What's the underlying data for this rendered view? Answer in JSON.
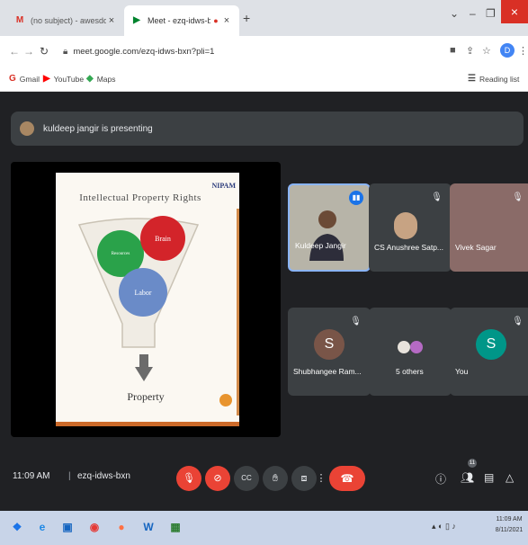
{
  "browser": {
    "tabs": [
      {
        "label": "(no subject) - awesddfsertanda"
      },
      {
        "label": "Meet - ezq-idws-bxn"
      }
    ],
    "url": "meet.google.com/ezq-idws-bxn?pli=1",
    "profile_initial": "D",
    "bookmarks": [
      "Gmail",
      "YouTube",
      "Maps"
    ],
    "reading_list": "Reading list"
  },
  "meet": {
    "presenting": "kuldeep jangir is presenting",
    "slide": {
      "title": "Intellectual Property Rights",
      "logo": "NIPAM",
      "circles": [
        "Resources",
        "Brain",
        "Labor"
      ],
      "bottom_label": "Property"
    },
    "tiles": [
      {
        "name": "Kuldeep Jangir"
      },
      {
        "name": "CS Anushree Satp..."
      },
      {
        "name": "Vivek Sagar"
      },
      {
        "name": "Shubhangee Ram...",
        "letter": "S"
      },
      {
        "name": "5 others"
      },
      {
        "name": "You",
        "letter": "S"
      }
    ],
    "time": "11:09 AM",
    "separator": "|",
    "meeting_code": "ezq-idws-bxn",
    "participants_badge": "11"
  },
  "taskbar": {
    "clock_time": "11:09 AM",
    "clock_date": "8/11/2021"
  },
  "icons": {
    "gmail": "gmail-icon",
    "meet": "meet-icon",
    "mic_off": "mic-off-icon",
    "camera_off": "camera-off-icon",
    "captions": "captions-icon",
    "raise_hand": "raise-hand-icon",
    "present": "present-icon",
    "more": "more-icon",
    "end_call": "end-call-icon",
    "info": "info-icon",
    "people": "people-icon",
    "chat": "chat-icon",
    "activities": "activities-icon"
  },
  "colors": {
    "meet_bg": "#202124",
    "tile_bg": "#3c4043",
    "red_button": "#ea4335",
    "accent_blue": "#1a73e8"
  }
}
